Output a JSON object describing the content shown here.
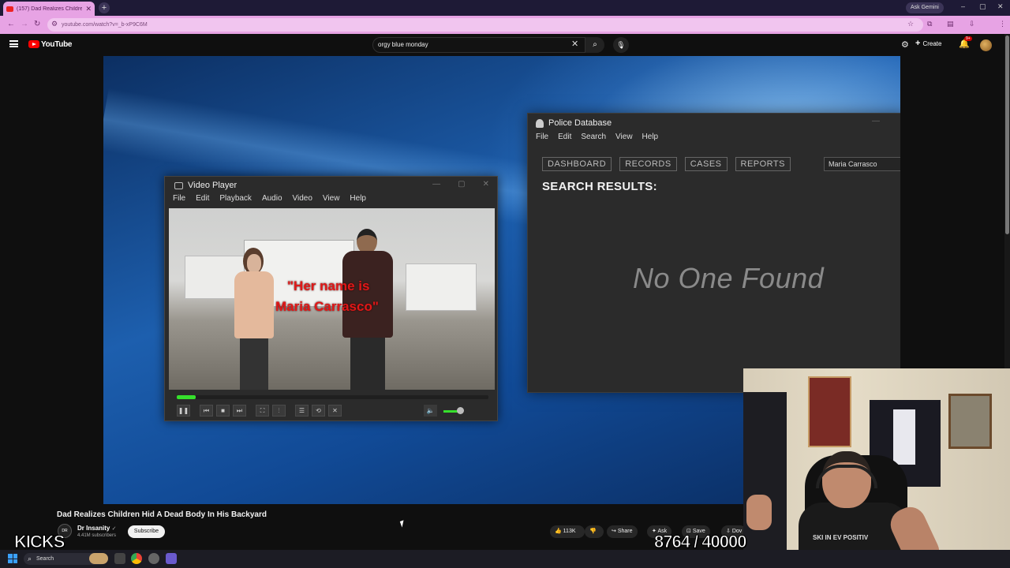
{
  "browser": {
    "tab_title": "(157) Dad Realizes Children...",
    "tab_close": "✕",
    "new_tab": "+",
    "ask_gemini": "Ask Gemini",
    "url": "youtube.com/watch?v=_b-xP9C6M",
    "controls": {
      "minimize": "–",
      "maximize": "▢",
      "close": "✕"
    }
  },
  "youtube": {
    "logo_text": "YouTube",
    "search_query": "orgy blue monday",
    "create_label": "Create",
    "notif_count": "9+"
  },
  "video_player": {
    "title": "Video Player",
    "menu": [
      "File",
      "Edit",
      "Playback",
      "Audio",
      "Video",
      "View",
      "Help"
    ],
    "caption_line1": "\"Her name is",
    "caption_line2": "Maria Carrasco\"",
    "progress": 0.06,
    "volume": 0.7
  },
  "police_db": {
    "title": "Police Database",
    "menu": [
      "File",
      "Edit",
      "Search",
      "View",
      "Help"
    ],
    "tabs": [
      "DASHBOARD",
      "RECORDS",
      "CASES",
      "REPORTS"
    ],
    "search_value": "Maria Carrasco",
    "heading": "SEARCH RESULTS:",
    "empty_message": "No One Found"
  },
  "video_info": {
    "title": "Dad Realizes Children Hid A Dead Body In His Backyard",
    "channel": "Dr Insanity",
    "verified_mark": "✓",
    "subscribers": "4.41M subscribers",
    "subscribe_label": "Subscribe",
    "likes": "113K",
    "share_label": "Share",
    "ask_label": "Ask",
    "save_label": "Save",
    "download_label": "Dov"
  },
  "overlay": {
    "kicks_label": "KICKS",
    "kicks_counter": "8764 / 40000",
    "shirt_text": "SKI IN EV POSITIV"
  },
  "taskbar": {
    "search_placeholder": "Search"
  },
  "colors": {
    "tab_active": "#e7a3e4",
    "youtube_red": "#ff0000",
    "player_progress": "#36e02c",
    "caption_red": "#e01818"
  }
}
